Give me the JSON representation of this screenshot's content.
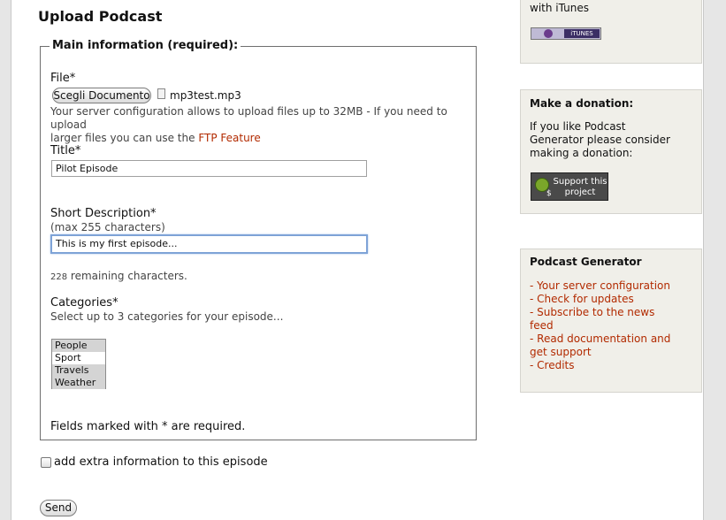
{
  "page_title": "Upload Podcast",
  "fieldset_legend": "Main information (required):",
  "file": {
    "label": "File*",
    "choose_button": "Scegli Documento",
    "filename": "mp3test.mp3",
    "note_part1": "Your server configuration allows to upload files up to 32MB - If you need to upload",
    "note_part2": "larger files you can use the",
    "ftp_link": "FTP Feature"
  },
  "title_field": {
    "label": "Title*",
    "value": "Pilot Episode"
  },
  "description": {
    "label": "Short Description*",
    "hint": "(max 255 characters)",
    "value": "This is my first episode...",
    "remaining_count": "228",
    "remaining_text": "remaining characters."
  },
  "categories": {
    "label": "Categories*",
    "hint": "Select up to 3 categories for your episode...",
    "options": [
      {
        "label": "People",
        "selected": true
      },
      {
        "label": "Sport",
        "selected": false
      },
      {
        "label": "Travels",
        "selected": true
      },
      {
        "label": "Weather",
        "selected": true
      }
    ]
  },
  "required_note": "Fields marked with * are required.",
  "extra_info": {
    "label": "add extra information to this episode",
    "checked": false
  },
  "send_button": "Send",
  "sidebar": {
    "itunes_box": {
      "text": "with iTunes",
      "badge_label": "iTUNES"
    },
    "donation_box": {
      "title": "Make a donation:",
      "line1": "If you like Podcast",
      "line2": "Generator please consider",
      "line3": "making a donation:",
      "badge_line1": "Support this",
      "badge_line2": "project",
      "badge_symbol": "$"
    },
    "podcast_box": {
      "title": "Podcast Generator",
      "links": [
        {
          "lines": [
            "Your server configuration"
          ]
        },
        {
          "lines": [
            "Check for updates"
          ]
        },
        {
          "lines": [
            "Subscribe to the news",
            "feed"
          ]
        },
        {
          "lines": [
            "Read documentation and",
            "get support"
          ]
        },
        {
          "lines": [
            "Credits"
          ]
        }
      ]
    }
  },
  "colors": {
    "link": "#b22a00",
    "sidebar_bg": "#f0efe9",
    "focus_ring": "#7ea3d7"
  }
}
